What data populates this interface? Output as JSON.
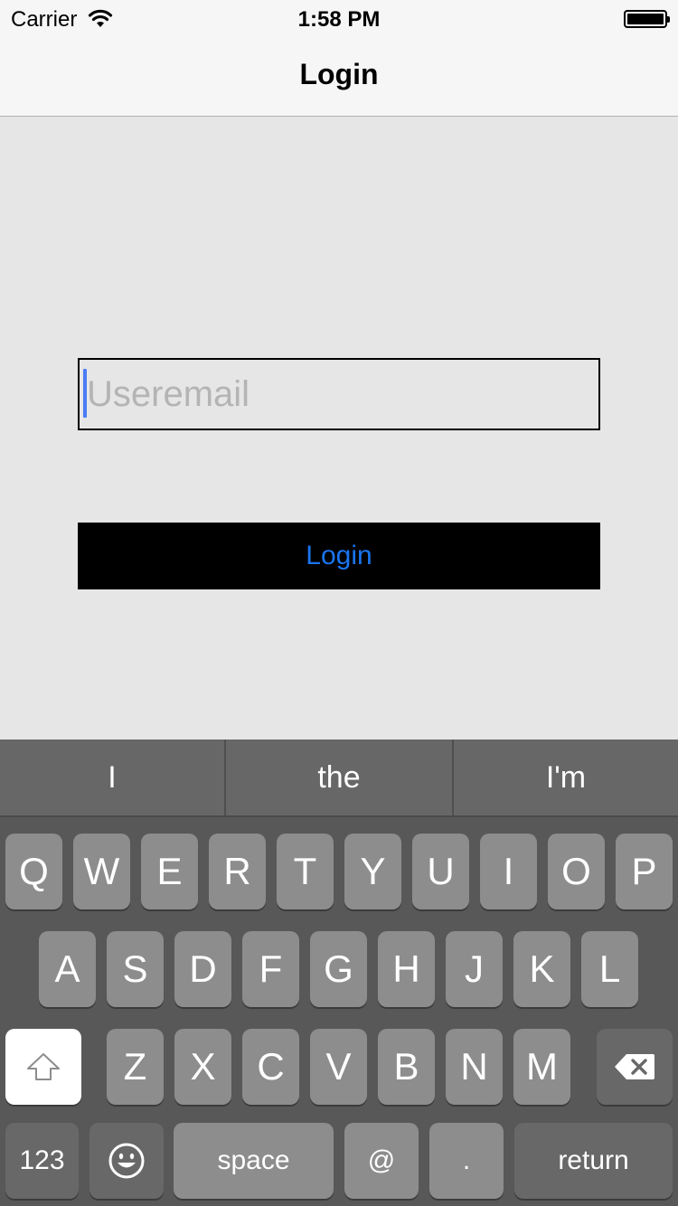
{
  "status_bar": {
    "carrier": "Carrier",
    "time": "1:58 PM",
    "wifi_icon": "wifi-icon",
    "battery_icon": "battery-icon"
  },
  "nav": {
    "title": "Login"
  },
  "form": {
    "email_placeholder": "Useremail",
    "email_value": "",
    "login_label": "Login",
    "login_color": "#1a75f0"
  },
  "keyboard": {
    "suggestions": [
      "I",
      "the",
      "I'm"
    ],
    "row1": [
      "Q",
      "W",
      "E",
      "R",
      "T",
      "Y",
      "U",
      "I",
      "O",
      "P"
    ],
    "row2": [
      "A",
      "S",
      "D",
      "F",
      "G",
      "H",
      "J",
      "K",
      "L"
    ],
    "row3": [
      "Z",
      "X",
      "C",
      "V",
      "B",
      "N",
      "M"
    ],
    "shift_icon": "shift-icon",
    "delete_icon": "backspace-icon",
    "emoji_icon": "emoji-icon",
    "numbers_label": "123",
    "space_label": "space",
    "at_label": "@",
    "dot_label": ".",
    "return_label": "return"
  }
}
